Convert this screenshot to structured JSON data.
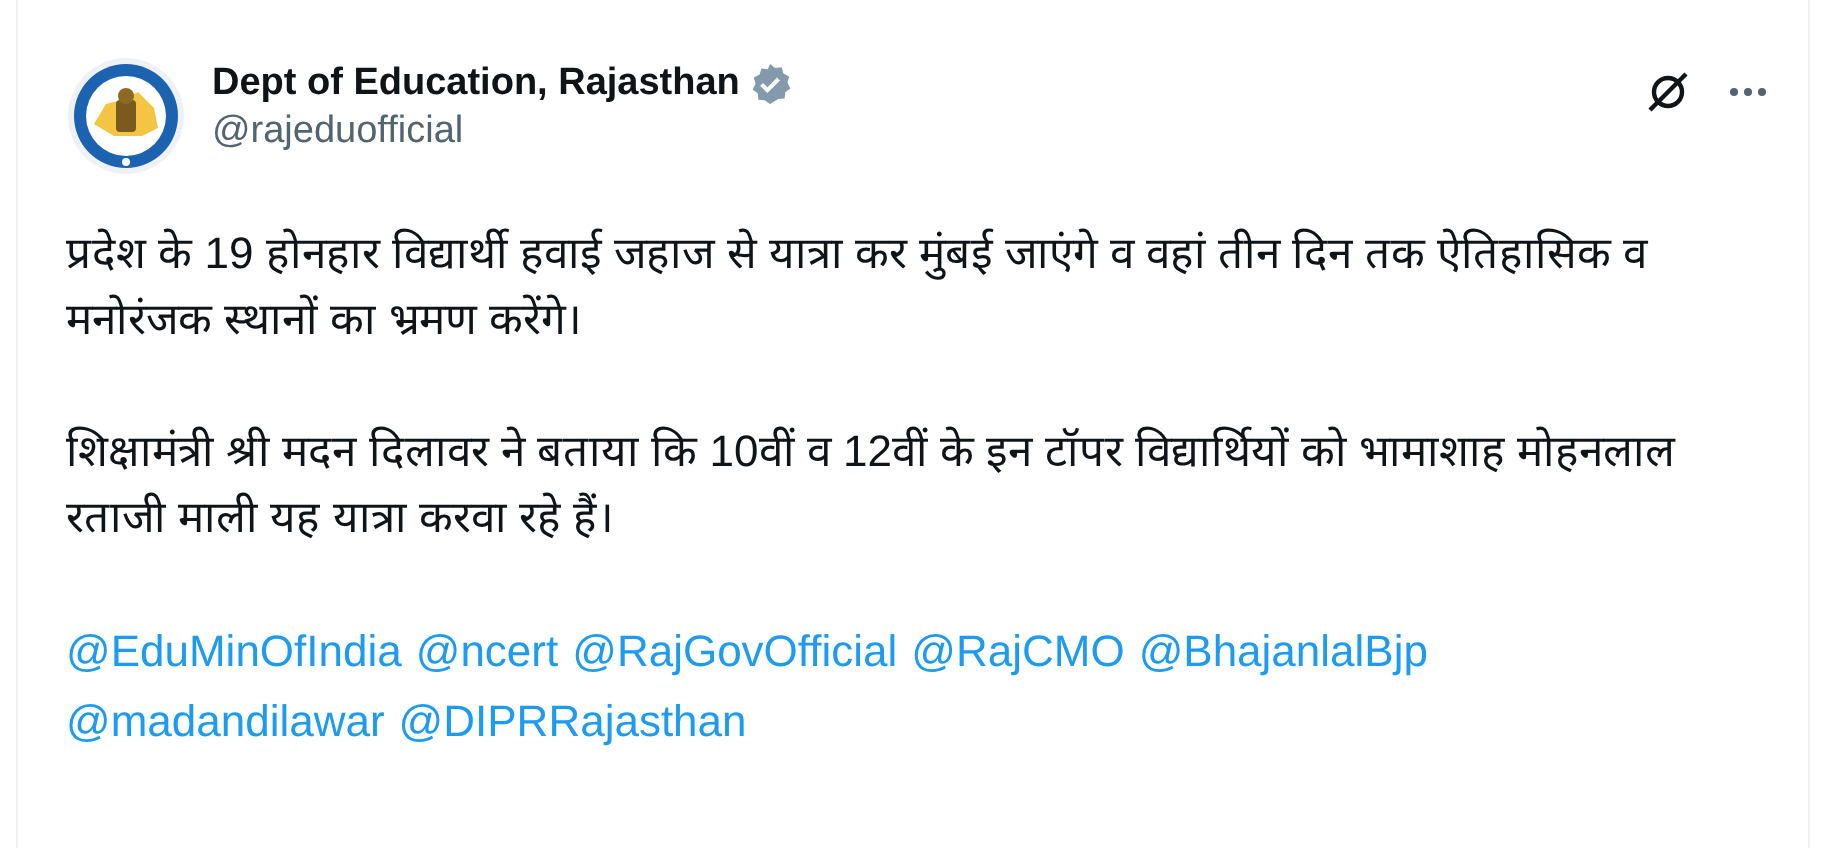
{
  "author": {
    "name": "Dept of Education, Rajasthan",
    "handle": "@rajeduofficial",
    "verified": true
  },
  "paragraphs": [
    "प्रदेश के 19 होनहार विद्यार्थी हवाई जहाज से यात्रा कर मुंबई जाएंगे व वहां तीन दिन तक ऐतिहासिक व मनोरंजक स्थानों का भ्रमण करेंगे।",
    "शिक्षामंत्री श्री मदन दिलावर ने बताया कि 10वीं व 12वीं के इन टॉपर विद्यार्थियों को भामाशाह मोहनलाल रताजी माली यह यात्रा करवा रहे हैं।"
  ],
  "mentions": [
    "@EduMinOfIndia",
    "@ncert",
    "@RajGovOfficial",
    "@RajCMO",
    "@BhajanlalBjp",
    "@madandilawar",
    "@DIPRRajasthan"
  ]
}
